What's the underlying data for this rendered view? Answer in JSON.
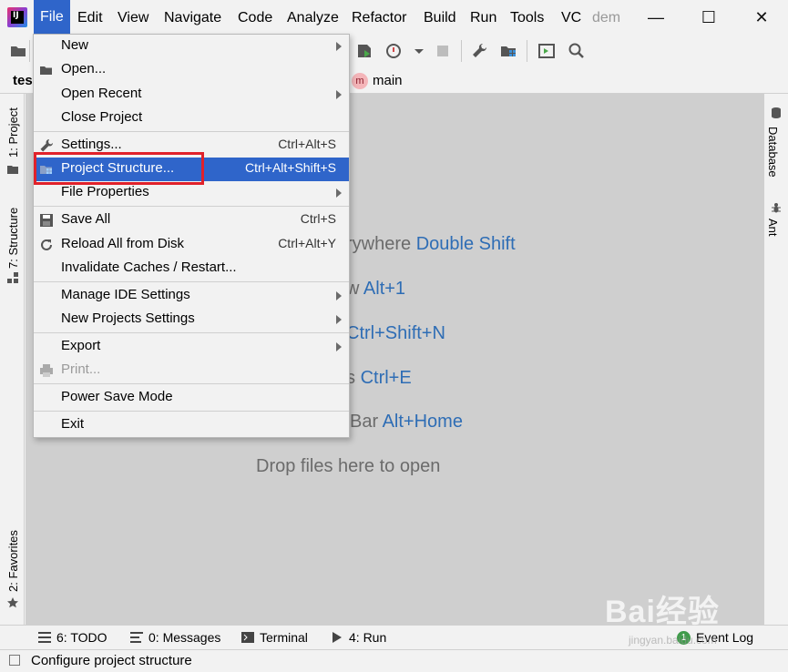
{
  "menubar": {
    "items": [
      {
        "label": "File",
        "mnemonic_index": 0
      },
      {
        "label": "Edit"
      },
      {
        "label": "View"
      },
      {
        "label": "Navigate"
      },
      {
        "label": "Code"
      },
      {
        "label": "Analyze"
      },
      {
        "label": "Refactor"
      },
      {
        "label": "Build"
      },
      {
        "label": "Run"
      },
      {
        "label": "Tools"
      },
      {
        "label": "VC"
      }
    ],
    "project_name": "dem",
    "logo_text": "IJ"
  },
  "window": {
    "minimize": "—",
    "maximize": "☐",
    "close": "✕"
  },
  "navbar": {
    "project": "tes",
    "branch_icon": "m",
    "branch": "main"
  },
  "left_tabs": {
    "project": "1: Project",
    "structure": "7: Structure",
    "favorites": "2: Favorites"
  },
  "right_tabs": {
    "database": "Database",
    "ant": "Ant"
  },
  "file_menu": {
    "items": [
      {
        "label": "New",
        "submenu": true
      },
      {
        "label": "Open...",
        "icon": "folder-icon"
      },
      {
        "label": "Open Recent",
        "submenu": true
      },
      {
        "label": "Close Project"
      },
      {
        "label": "Settings...",
        "shortcut": "Ctrl+Alt+S",
        "icon": "wrench-icon"
      },
      {
        "label": "Project Structure...",
        "shortcut": "Ctrl+Alt+Shift+S",
        "icon": "project-structure-icon",
        "selected": true
      },
      {
        "label": "File Properties",
        "submenu": true
      },
      {
        "label": "Save All",
        "shortcut": "Ctrl+S",
        "icon": "save-icon"
      },
      {
        "label": "Reload All from Disk",
        "shortcut": "Ctrl+Alt+Y",
        "icon": "reload-icon"
      },
      {
        "label": "Invalidate Caches / Restart..."
      },
      {
        "label": "Manage IDE Settings",
        "submenu": true
      },
      {
        "label": "New Projects Settings",
        "submenu": true
      },
      {
        "label": "Export",
        "submenu": true
      },
      {
        "label": "Print...",
        "icon": "print-icon",
        "disabled": true
      },
      {
        "label": "Power Save Mode"
      },
      {
        "label": "Exit"
      }
    ]
  },
  "editor_hints": [
    {
      "text": "rywhere ",
      "key": "Double Shift"
    },
    {
      "text": "w ",
      "key": "Alt+1"
    },
    {
      "text": "",
      "key": "Ctrl+Shift+N"
    },
    {
      "text": "s ",
      "key": "Ctrl+E"
    },
    {
      "text": " Bar ",
      "key": "Alt+Home"
    }
  ],
  "drop_hint": "Drop files here to open",
  "bottom_tabs": {
    "todo": "6: TODO",
    "messages": "0: Messages",
    "terminal": "Terminal",
    "run": "4: Run",
    "event_log": "Event Log",
    "event_count": "1"
  },
  "status": {
    "text": "Configure project structure"
  },
  "watermark": {
    "main": "Bai",
    "logo": "经验",
    "sub": "jingyan.baidu.com"
  },
  "colors": {
    "accent": "#2f65ca",
    "highlight": "#e0212a",
    "shortcut_blue": "#2e6db5"
  }
}
